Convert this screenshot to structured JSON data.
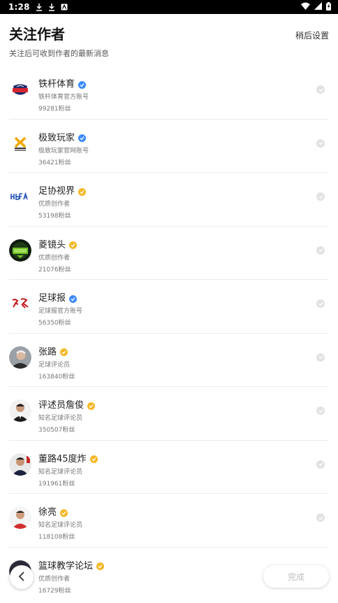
{
  "status_bar": {
    "time": "1:28"
  },
  "header": {
    "title": "关注作者",
    "subtitle": "关注后可收到作者的最新消息",
    "later_label": "稍后设置"
  },
  "authors": [
    {
      "name": "铁杆体育",
      "desc": "铁杆体育官方账号",
      "fans": "99281粉丝",
      "badge": "blue"
    },
    {
      "name": "极致玩家",
      "desc": "极致玩家官网账号",
      "fans": "36421粉丝",
      "badge": "blue"
    },
    {
      "name": "足协视界",
      "desc": "优质创作者",
      "fans": "53198粉丝",
      "badge": "gold"
    },
    {
      "name": "菱镜头",
      "desc": "优质创作者",
      "fans": "21076粉丝",
      "badge": "gold"
    },
    {
      "name": "足球报",
      "desc": "足球报官方账号",
      "fans": "56350粉丝",
      "badge": "blue"
    },
    {
      "name": "张路",
      "desc": "足球评论员",
      "fans": "163840粉丝",
      "badge": "gold"
    },
    {
      "name": "评述员詹俊",
      "desc": "知名足球评论员",
      "fans": "350507粉丝",
      "badge": "gold"
    },
    {
      "name": "董路45度炸",
      "desc": "知名足球评论员",
      "fans": "191961粉丝",
      "badge": "gold"
    },
    {
      "name": "徐亮",
      "desc": "知名足球评论员",
      "fans": "118108粉丝",
      "badge": "gold"
    },
    {
      "name": "篮球教学论坛",
      "desc": "优质创作者",
      "fans": "16729粉丝",
      "badge": "gold"
    }
  ],
  "footer": {
    "done_label": "完成"
  }
}
